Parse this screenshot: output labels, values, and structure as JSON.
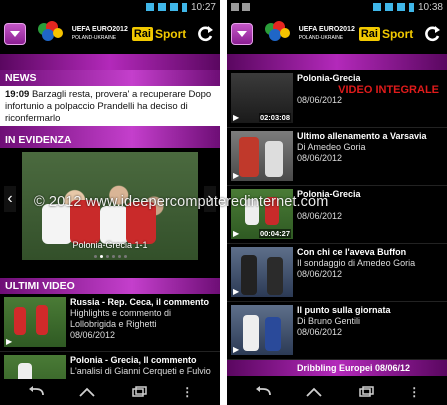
{
  "left": {
    "status_time": "10:27",
    "news_header": "NEWS",
    "news_time": "19:09",
    "news_text": "Barzagli resta, provera' a recuperare Dopo infortunio a polpaccio Prandelli ha deciso di riconfermarlo",
    "highlight_header": "IN EVIDENZA",
    "carousel_caption": "Polonia-Grecia 1-1",
    "latest_header": "ULTIMI VIDEO",
    "videos": [
      {
        "title": "Russia - Rep. Ceca, il commento",
        "subtitle": "Highlights e commento di Lollobrigida e Righetti",
        "date": "08/06/2012"
      },
      {
        "title": "Polonia - Grecia, Il commento",
        "subtitle": "L'analisi di Gianni Cerqueti e Fulvio",
        "date": ""
      }
    ]
  },
  "right": {
    "status_time": "10:38",
    "video_integrale": "VIDEO INTEGRALE",
    "videos": [
      {
        "title": "Polonia-Grecia",
        "subtitle": "",
        "date": "08/06/2012",
        "duration": "02:03:08"
      },
      {
        "title": "Ultimo allenamento a Varsavia",
        "subtitle": "Di Amedeo Goria",
        "date": "08/06/2012",
        "duration": ""
      },
      {
        "title": "Polonia-Grecia",
        "subtitle": "",
        "date": "08/06/2012",
        "duration": "00:04:27"
      },
      {
        "title": "Con chi ce l'aveva Buffon",
        "subtitle": "Il sondaggio di Amedeo Goria",
        "date": "08/06/2012",
        "duration": ""
      },
      {
        "title": "Il punto sulla giornata",
        "subtitle": "Di Bruno Gentili",
        "date": "08/06/2012",
        "duration": ""
      }
    ],
    "bottom_item": "Dribbling Europei 08/06/12"
  },
  "logo": {
    "euro_text": "UEFA EURO2012",
    "euro_sub": "POLAND-UKRAINE",
    "rai_box": "Rai",
    "rai_sport": "Sport"
  },
  "watermark": "© 2012 www.ideepercomputeredinternet.com",
  "colors": {
    "accent": "#b329ba",
    "rai_yellow": "#f2c900",
    "status_blue": "#3fb6e8",
    "video_integrale_red": "#e01b1b"
  },
  "icons": {
    "menu": "menu-icon",
    "refresh": "refresh-icon",
    "back": "back-icon",
    "home": "home-icon",
    "recent": "recent-apps-icon",
    "overflow": "overflow-menu-icon",
    "play": "play-icon",
    "prev": "chevron-left-icon",
    "next": "chevron-right-icon"
  }
}
